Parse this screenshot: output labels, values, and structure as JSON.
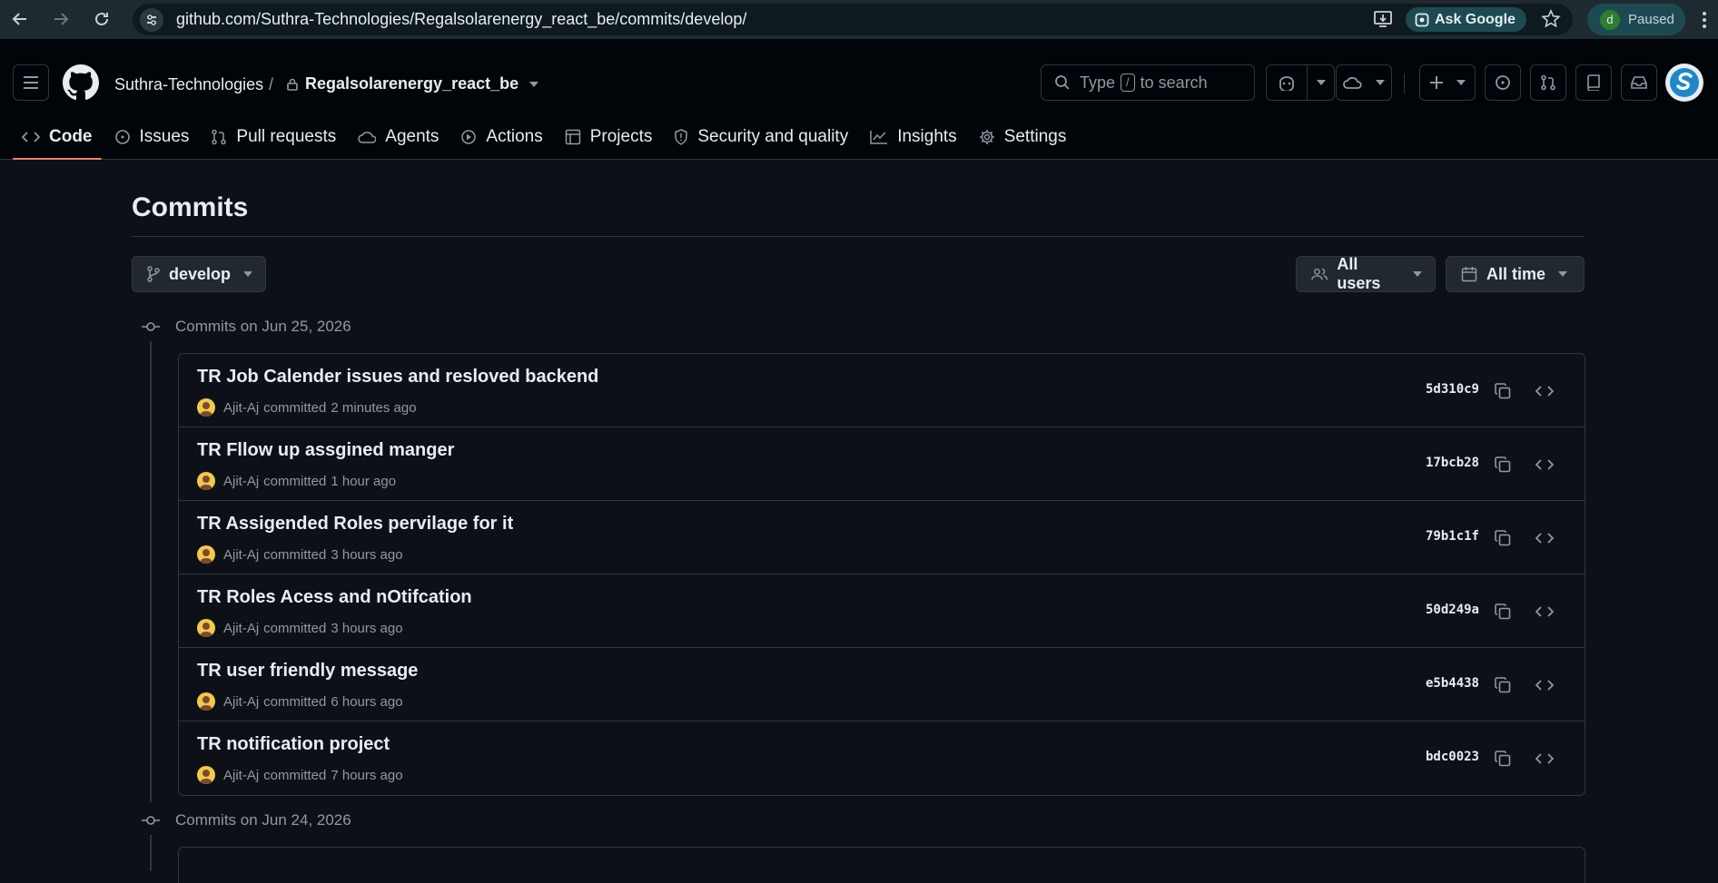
{
  "browser": {
    "url": "github.com/Suthra-Technologies/Regalsolarenergy_react_be/commits/develop/",
    "ask_google_label": "Ask Google",
    "profile_initial": "d",
    "profile_status": "Paused"
  },
  "repo_header": {
    "owner": "Suthra-Technologies",
    "separator": "/",
    "repo_name": "Regalsolarenergy_react_be",
    "search_prefix": "Type",
    "search_key": "/",
    "search_suffix": "to search"
  },
  "tabs": [
    {
      "label": "Code",
      "icon": "code-icon",
      "active": true
    },
    {
      "label": "Issues",
      "icon": "issue-opened-icon"
    },
    {
      "label": "Pull requests",
      "icon": "git-pull-request-icon"
    },
    {
      "label": "Agents",
      "icon": "agent-icon"
    },
    {
      "label": "Actions",
      "icon": "play-icon"
    },
    {
      "label": "Projects",
      "icon": "table-icon"
    },
    {
      "label": "Security and quality",
      "icon": "shield-icon"
    },
    {
      "label": "Insights",
      "icon": "graph-icon"
    },
    {
      "label": "Settings",
      "icon": "gear-icon"
    }
  ],
  "page": {
    "title": "Commits",
    "branch": "develop",
    "users_filter": "All users",
    "time_filter": "All time"
  },
  "groups": [
    {
      "heading": "Commits on Jun 25, 2026",
      "commits": [
        {
          "message": "TR Job Calender issues and resloved backend",
          "author": "Ajit-Aj",
          "action": "committed",
          "time": "2 minutes ago",
          "sha": "5d310c9"
        },
        {
          "message": "TR Fllow up assgined manger",
          "author": "Ajit-Aj",
          "action": "committed",
          "time": "1 hour ago",
          "sha": "17bcb28"
        },
        {
          "message": "TR Assigended Roles pervilage for it",
          "author": "Ajit-Aj",
          "action": "committed",
          "time": "3 hours ago",
          "sha": "79b1c1f"
        },
        {
          "message": "TR Roles Acess and nOtifcation",
          "author": "Ajit-Aj",
          "action": "committed",
          "time": "3 hours ago",
          "sha": "50d249a"
        },
        {
          "message": "TR user friendly message",
          "author": "Ajit-Aj",
          "action": "committed",
          "time": "6 hours ago",
          "sha": "e5b4438"
        },
        {
          "message": "TR notification project",
          "author": "Ajit-Aj",
          "action": "committed",
          "time": "7 hours ago",
          "sha": "bdc0023"
        }
      ]
    },
    {
      "heading": "Commits on Jun 24, 2026",
      "commits": []
    }
  ],
  "colors": {
    "background": "#0d1117",
    "header": "#010409",
    "accent_underline": "#f78166",
    "border": "#30363d"
  }
}
